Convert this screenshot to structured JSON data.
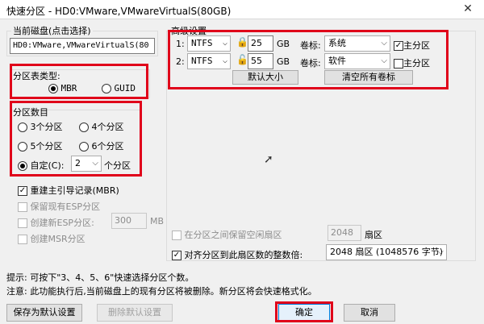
{
  "window": {
    "title": "快速分区 - HD0:VMware,VMwareVirtualS(80GB)",
    "close": "✕"
  },
  "disk": {
    "group_label": "当前磁盘(点击选择)",
    "current": "HD0:VMware,VMwareVirtualS(80"
  },
  "table_type": {
    "label": "分区表类型:",
    "options": [
      "MBR",
      "GUID"
    ],
    "selected": "MBR"
  },
  "count": {
    "label": "分区数目",
    "options": [
      "3个分区",
      "4个分区",
      "5个分区",
      "6个分区"
    ],
    "custom_label": "自定(C):",
    "custom_value": "2",
    "custom_suffix": "个分区"
  },
  "checks": {
    "rebuild_mbr": "重建主引导记录(MBR)",
    "keep_esp": "保留现有ESP分区",
    "create_esp": "创建新ESP分区:",
    "esp_size": "300",
    "esp_unit": "MB",
    "create_msr": "创建MSR分区"
  },
  "advanced": {
    "label": "高级设置",
    "rows": [
      {
        "index": "1:",
        "fs": "NTFS",
        "size": "25",
        "unit": "GB",
        "vol_label": "卷标:",
        "volume": "系统",
        "primary": "主分区",
        "primary_checked": true
      },
      {
        "index": "2:",
        "fs": "NTFS",
        "size": "55",
        "unit": "GB",
        "vol_label": "卷标:",
        "volume": "软件",
        "primary": "主分区",
        "primary_checked": false
      }
    ],
    "default_size": "默认大小",
    "clear_labels": "清空所有卷标"
  },
  "align": {
    "reserve_label": "在分区之间保留空闲扇区",
    "reserve_value": "2048",
    "reserve_unit": "扇区",
    "align_label": "对齐分区到此扇区数的整数倍:",
    "align_value": "2048 扇区 (1048576 字节)"
  },
  "hints": {
    "tip": "提示: 可按下\"3、4、5、6\"快速选择分区个数。",
    "note": "注意: 此功能执行后,当前磁盘上的现有分区将被删除。新分区将会快速格式化。"
  },
  "buttons": {
    "save_default": "保存为默认设置",
    "delete_default": "删除默认设置",
    "ok": "确定",
    "cancel": "取消"
  },
  "colors": {
    "highlight": "#e0001a"
  }
}
